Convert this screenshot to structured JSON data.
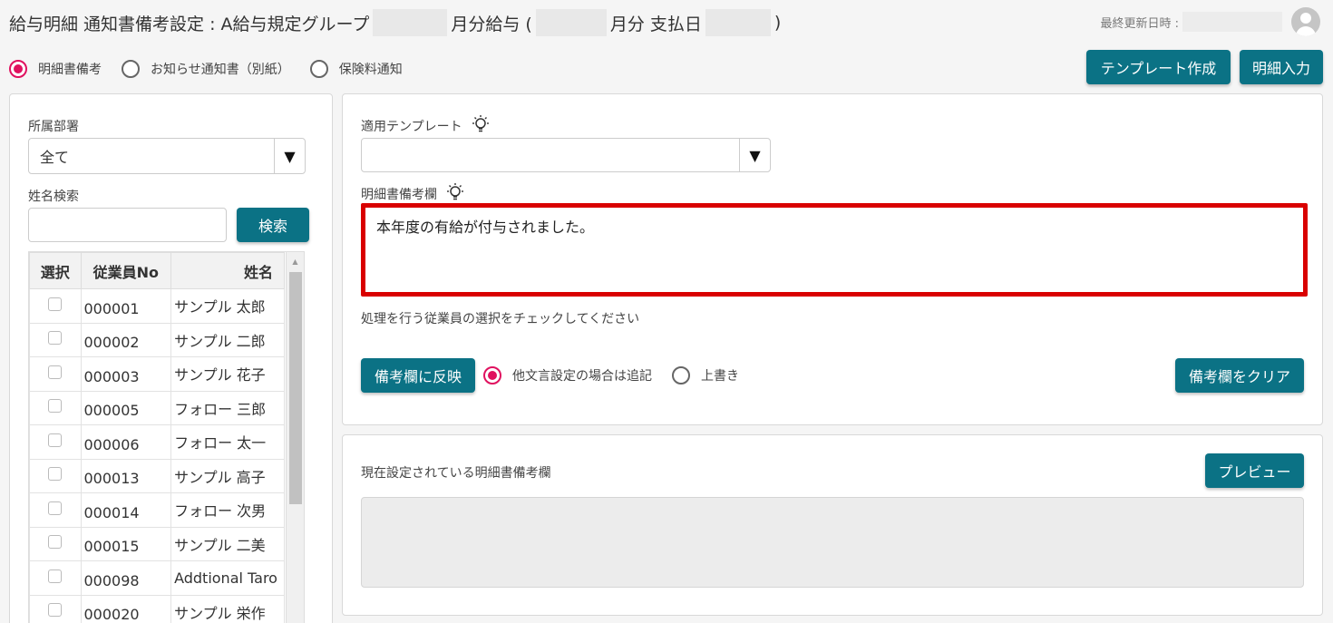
{
  "header": {
    "title_prefix": "給与明細 通知書備考設定 : A給与規定グループ",
    "title_month": "月分給与 (",
    "title_paren_month": "月分 支払日",
    "title_close": ")",
    "updated_label": "最終更新日時 :"
  },
  "mode_options": [
    {
      "label": "明細書備考",
      "selected": true
    },
    {
      "label": "お知らせ通知書（別紙）",
      "selected": false
    },
    {
      "label": "保険料通知",
      "selected": false
    }
  ],
  "toolbar": {
    "template_create": "テンプレート作成",
    "detail_input": "明細入力"
  },
  "left": {
    "dept_label": "所属部署",
    "dept_value": "全て",
    "name_search_label": "姓名検索",
    "name_search_value": "",
    "search_button": "検索",
    "columns": [
      "選択",
      "従業員No",
      "姓名"
    ],
    "rows": [
      {
        "no": "000001",
        "name": "サンプル 太郎",
        "checked": false
      },
      {
        "no": "000002",
        "name": "サンプル 二郎",
        "checked": false
      },
      {
        "no": "000003",
        "name": "サンプル 花子",
        "checked": false
      },
      {
        "no": "000005",
        "name": "フォロー 三郎",
        "checked": false
      },
      {
        "no": "000006",
        "name": "フォロー 太一",
        "checked": false
      },
      {
        "no": "000013",
        "name": "サンプル 高子",
        "checked": false
      },
      {
        "no": "000014",
        "name": "フォロー 次男",
        "checked": false
      },
      {
        "no": "000015",
        "name": "サンプル 二美",
        "checked": false
      },
      {
        "no": "000098",
        "name": "Addtional Taro",
        "checked": false
      },
      {
        "no": "000020",
        "name": "サンプル 栄作",
        "checked": false
      }
    ]
  },
  "right": {
    "template_label": "適用テンプレート",
    "template_value": "",
    "remarks_label": "明細書備考欄",
    "remarks_value": "本年度の有給が付与されました。",
    "instruction": "処理を行う従業員の選択をチェックしてください",
    "apply_button": "備考欄に反映",
    "apply_options": [
      {
        "label": "他文言設定の場合は追記",
        "selected": true
      },
      {
        "label": "上書き",
        "selected": false
      }
    ],
    "clear_button": "備考欄をクリア",
    "current_label": "現在設定されている明細書備考欄",
    "preview_button": "プレビュー",
    "current_value": ""
  },
  "colors": {
    "accent": "#0b7285",
    "radio_selected": "#e0115f",
    "highlight": "#d90000"
  }
}
